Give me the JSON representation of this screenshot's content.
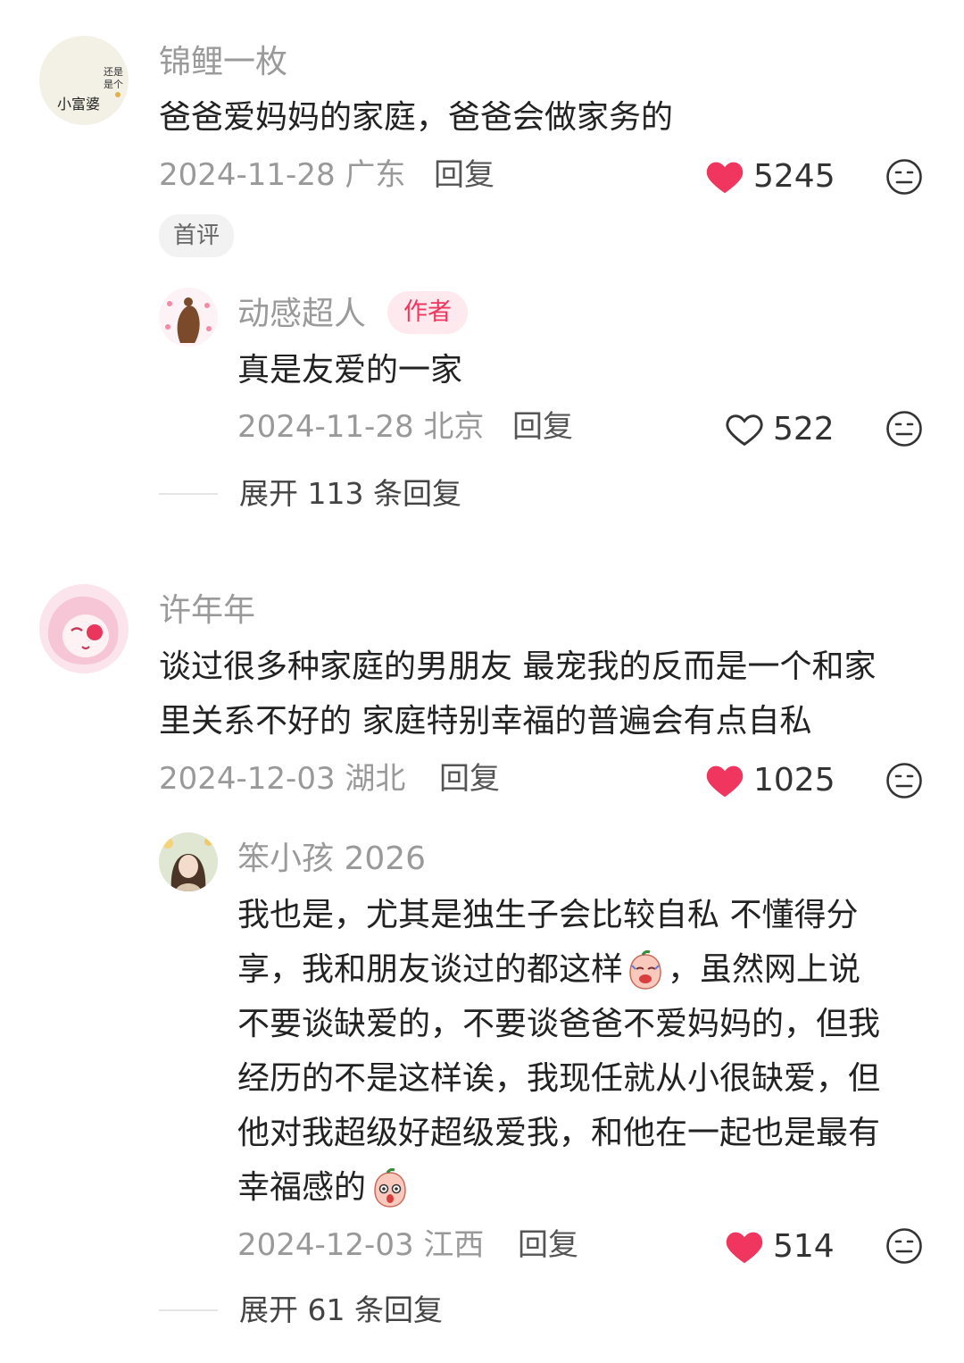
{
  "comments": [
    {
      "username": "锦鲤一枚",
      "avatar_text": [
        "还是",
        "是个",
        "小富婆"
      ],
      "text": "爸爸爱妈妈的家庭，爸爸会做家务的",
      "date_location": "2024-11-28 广东",
      "reply_label": "回复",
      "likes": "5245",
      "liked": true,
      "badge": "首评",
      "replies": [
        {
          "username": "动感超人",
          "author_badge": "作者",
          "text": "真是友爱的一家",
          "date_location": "2024-11-28 北京",
          "reply_label": "回复",
          "likes": "522",
          "liked": false
        }
      ],
      "expand_label": "展开 113 条回复"
    },
    {
      "username": "许年年",
      "text_lines": [
        "谈过很多种家庭的男朋友 最宠我的反而是一个和家",
        "里关系不好的 家庭特别幸福的普遍会有点自私"
      ],
      "date_location": "2024-12-03 湖北",
      "reply_label": "回复",
      "likes": "1025",
      "liked": true,
      "replies": [
        {
          "username": "笨小孩 2026",
          "text_lines": [
            "我也是，尤其是独生子会比较自私 不懂得分",
            "享，我和朋友谈过的都这样",
            "，虽然网上说",
            "不要谈缺爱的，不要谈爸爸不爱妈妈的，但我",
            "经历的不是这样诶，我现任就从小很缺爱，但",
            "他对我超级好超级爱我，和他在一起也是最有",
            "幸福感的"
          ],
          "date_location": "2024-12-03 江西",
          "reply_label": "回复",
          "likes": "514",
          "liked": true
        }
      ],
      "expand_label": "展开 61 条回复"
    }
  ],
  "colors": {
    "like_red": "#f0365f",
    "meta_gray": "#999999",
    "name_gray": "#9a9a9a",
    "text": "#222222"
  },
  "icons": {
    "like": "heart-icon",
    "dislike": "neutral-face-icon"
  }
}
